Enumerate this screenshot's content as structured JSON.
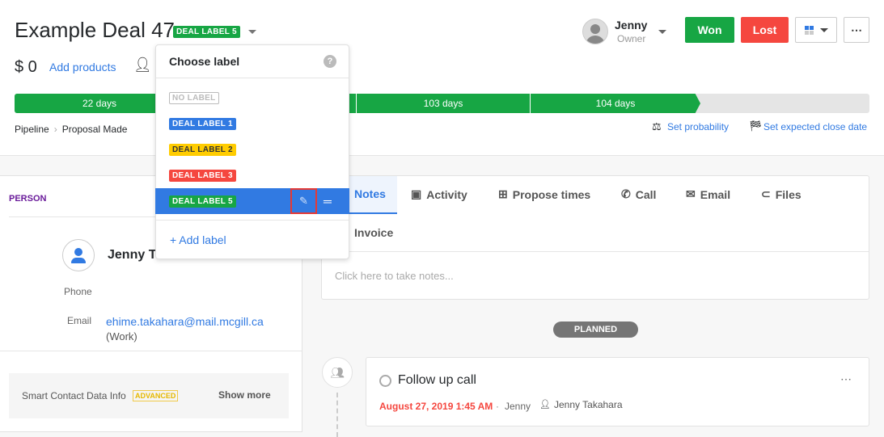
{
  "deal": {
    "title": "Example Deal 47",
    "label": "DEAL LABEL 5",
    "value": "$ 0",
    "add_products": "Add products"
  },
  "owner": {
    "name": "Jenny",
    "role": "Owner"
  },
  "actions": {
    "won": "Won",
    "lost": "Lost"
  },
  "pipeline": {
    "stages": [
      {
        "label": "22 days"
      },
      {
        "label": ""
      },
      {
        "label": "103 days"
      },
      {
        "label": "104 days"
      },
      {
        "label": ""
      }
    ],
    "breadcrumb": [
      "Pipeline",
      "Proposal Made"
    ],
    "set_probability": "Set probability",
    "set_close_date": "Set expected close date"
  },
  "dropdown": {
    "title": "Choose label",
    "items": [
      {
        "label": "NO LABEL",
        "color": "#ffffff"
      },
      {
        "label": "DEAL LABEL 1",
        "color": "#317ae2"
      },
      {
        "label": "DEAL LABEL 2",
        "color": "#ffcc00"
      },
      {
        "label": "DEAL LABEL 3",
        "color": "#f5473f"
      },
      {
        "label": "DEAL LABEL 5",
        "color": "#17a644",
        "selected": true
      }
    ],
    "add_label": "+ Add label"
  },
  "person": {
    "heading": "PERSON",
    "name": "Jenny T",
    "phone_label": "Phone",
    "email_label": "Email",
    "email": "ehime.takahara@mail.mcgill.ca",
    "email_type": "(Work)",
    "smart_info": "Smart Contact Data Info",
    "advanced": "ADVANCED",
    "show_more": "Show more"
  },
  "tabs": [
    "Notes",
    "Activity",
    "Propose times",
    "Call",
    "Email",
    "Files",
    "Invoice"
  ],
  "notes": {
    "placeholder": "Click here to take notes..."
  },
  "timeline": {
    "status": "PLANNED",
    "activity": {
      "title": "Follow up call",
      "date": "August 27, 2019 1:45 AM",
      "owner": "Jenny",
      "person": "Jenny Takahara"
    }
  },
  "colors": {
    "green": "#17a644",
    "red": "#f5473f",
    "blue": "#317ae2",
    "purple": "#6a1b9a"
  }
}
